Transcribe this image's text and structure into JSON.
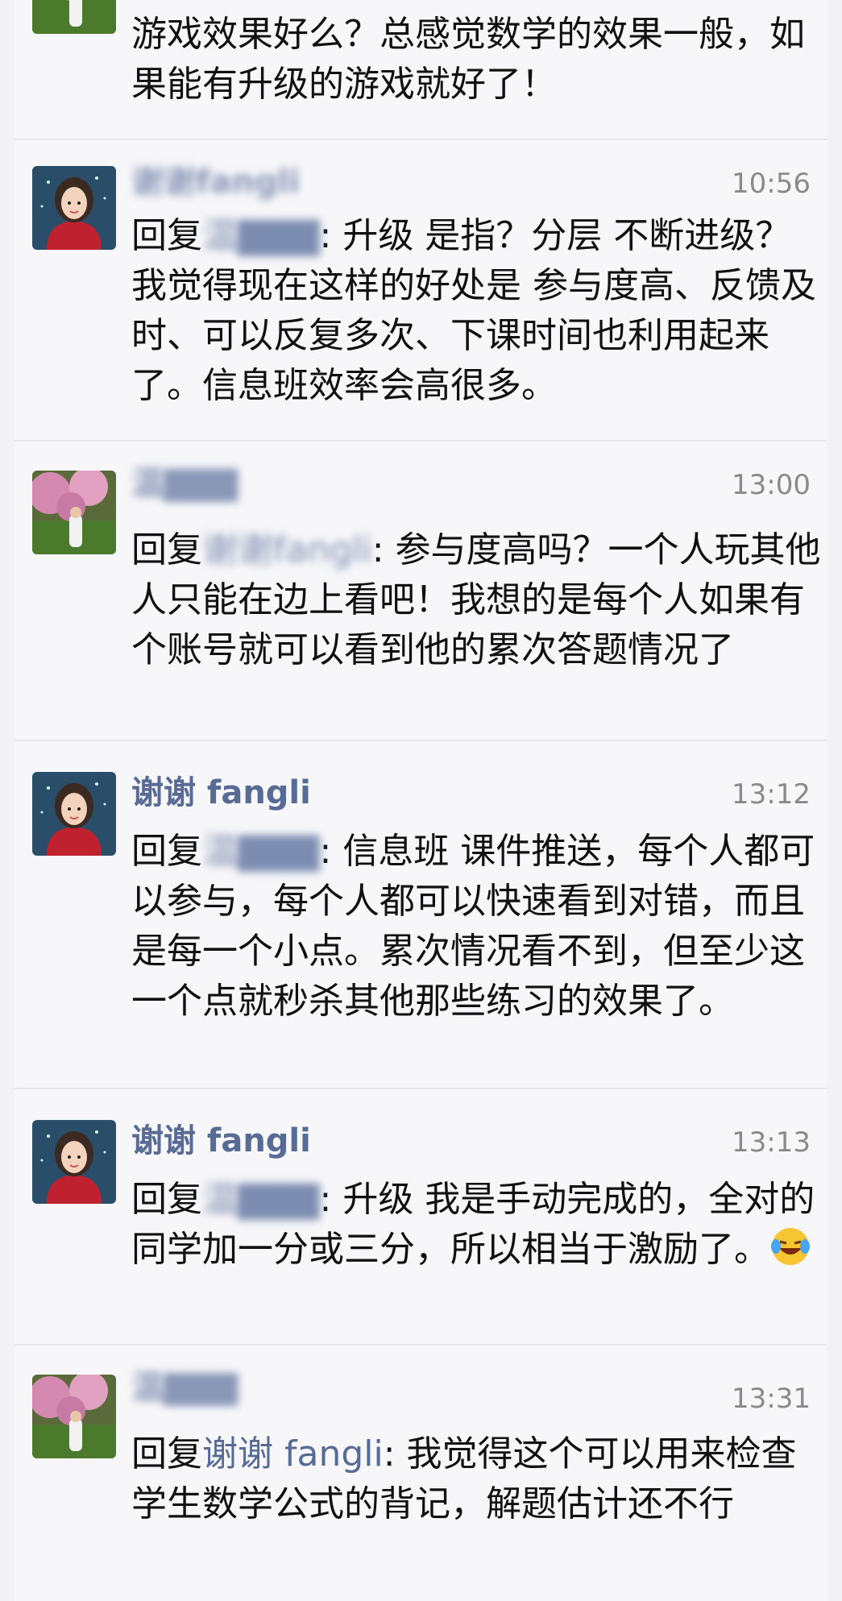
{
  "comments": [
    {
      "name": "",
      "time": "",
      "reply_word": "",
      "reply_target": "",
      "text": "游戏效果好么？总感觉数学的效果一般，如果能有升级的游戏就好了！"
    },
    {
      "name": "谢谢fangli",
      "time": "10:56",
      "reply_word": "回复",
      "reply_target": "温▇▇▇",
      "text": ": 升级 是指？分层 不断进级？我觉得现在这样的好处是 参与度高、反馈及时、可以反复多次、下课时间也利用起来了。信息班效率会高很多。"
    },
    {
      "name": "温▇▇▇",
      "time": "13:00",
      "reply_word": "回复",
      "reply_target": "谢谢fangli",
      "text": ": 参与度高吗？一个人玩其他人只能在边上看吧！我想的是每个人如果有个账号就可以看到他的累次答题情况了"
    },
    {
      "name": "谢谢 fangli",
      "time": "13:12",
      "reply_word": "回复",
      "reply_target": "温▇▇▇",
      "text": ": 信息班 课件推送，每个人都可以参与，每个人都可以快速看到对错，而且是每一个小点。累次情况看不到，但至少这一个点就秒杀其他那些练习的效果了。"
    },
    {
      "name": "谢谢 fangli",
      "time": "13:13",
      "reply_word": "回复",
      "reply_target": "温▇▇▇",
      "text": ": 升级 我是手动完成的，全对的同学加一分或三分，所以相当于激励了。",
      "emoji": "laughing-crying-emoji"
    },
    {
      "name": "温▇▇▇",
      "time": "13:31",
      "reply_word": "回复",
      "reply_target": "谢谢 fangli",
      "text": ": 我觉得这个可以用来检查学生数学公式的背记，解题估计还不行"
    }
  ],
  "colors": {
    "name": "#576b95",
    "time": "#8a8a8a",
    "text": "#111111",
    "background": "#f7f7f9"
  }
}
